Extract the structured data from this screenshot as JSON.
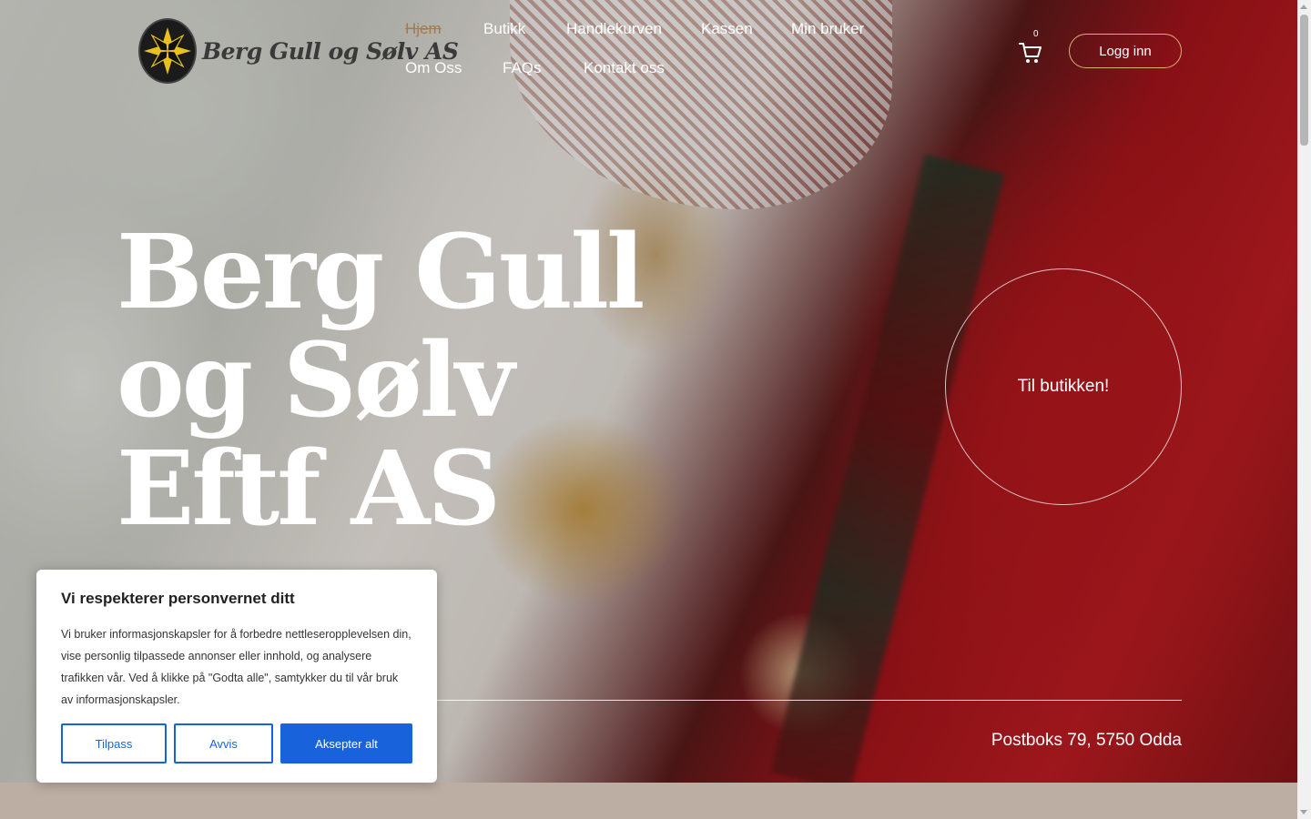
{
  "brand": {
    "name": "Berg Gull og Sølv AS"
  },
  "nav": {
    "items": [
      {
        "label": "Hjem",
        "active": true
      },
      {
        "label": "Butikk"
      },
      {
        "label": "Handlekurven"
      },
      {
        "label": "Kassen"
      },
      {
        "label": "Min bruker"
      },
      {
        "label": "Om Oss"
      },
      {
        "label": "FAQs"
      },
      {
        "label": "Kontakt oss"
      }
    ]
  },
  "cart": {
    "count": "0",
    "icon": "shopping-cart-icon"
  },
  "login": {
    "label": "Logg inn"
  },
  "hero": {
    "title_lines": [
      "Berg Gull",
      "og Sølv",
      "Eftf AS"
    ],
    "cta": "Til butikken!",
    "address": "Postboks 79, 5750 Odda"
  },
  "cookie_banner": {
    "title": "Vi respekterer personvernet ditt",
    "body": "Vi bruker informasjonskapsler for å forbedre nettleseropplevelsen din, vise personlig tilpassede annonser eller innhold, og analysere trafikken vår. Ved å klikke på \"Godta alle\", samtykker du til vår bruk av informasjonskapsler.",
    "buttons": {
      "customize": "Tilpass",
      "reject": "Avvis",
      "accept": "Aksepter alt"
    }
  },
  "colors": {
    "accent_gold": "#d8b07a",
    "active_nav": "#a67a4a",
    "cookie_blue": "#1863dc",
    "footer_band": "#bdaea4"
  }
}
